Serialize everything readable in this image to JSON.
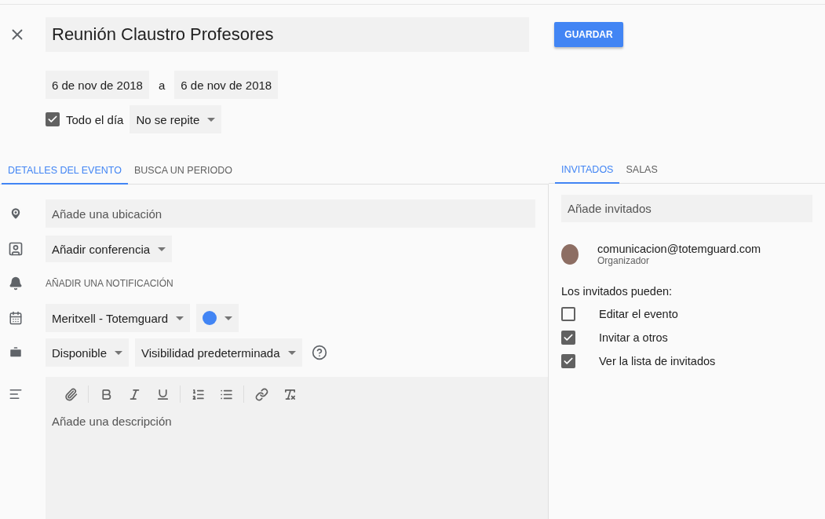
{
  "header": {
    "title": "Reunión Claustro Profesores",
    "save_button": "GUARDAR"
  },
  "dates": {
    "start": "6 de nov de 2018",
    "separator": "a",
    "end": "6 de nov de 2018"
  },
  "all_day": {
    "label": "Todo el día",
    "checked": true
  },
  "repeat": {
    "value": "No se repite"
  },
  "tabs": [
    {
      "label": "DETALLES DEL EVENTO",
      "selected": true
    },
    {
      "label": "BUSCA UN PERIODO",
      "selected": false
    }
  ],
  "details": {
    "location_placeholder": "Añade una ubicación",
    "conference": "Añadir conferencia",
    "notification": "AÑADIR UNA NOTIFICACIÓN",
    "calendar": "Meritxell - Totemguard",
    "color_picker": {
      "color": "#4285f4"
    },
    "availability": "Disponible",
    "visibility": "Visibilidad predeterminada",
    "description_placeholder": "Añade una descripción"
  },
  "guest_tabs": [
    {
      "label": "INVITADOS",
      "selected": true
    },
    {
      "label": "SALAS",
      "selected": false
    }
  ],
  "guests": {
    "placeholder": "Añade invitados",
    "list": [
      {
        "email": "comunicacion@totemguard.com",
        "role": "Organizador"
      }
    ],
    "permissions_label": "Los invitados pueden:",
    "permissions": [
      {
        "label": "Editar el evento",
        "checked": false
      },
      {
        "label": "Invitar a otros",
        "checked": true
      },
      {
        "label": "Ver la lista de invitados",
        "checked": true
      }
    ]
  }
}
